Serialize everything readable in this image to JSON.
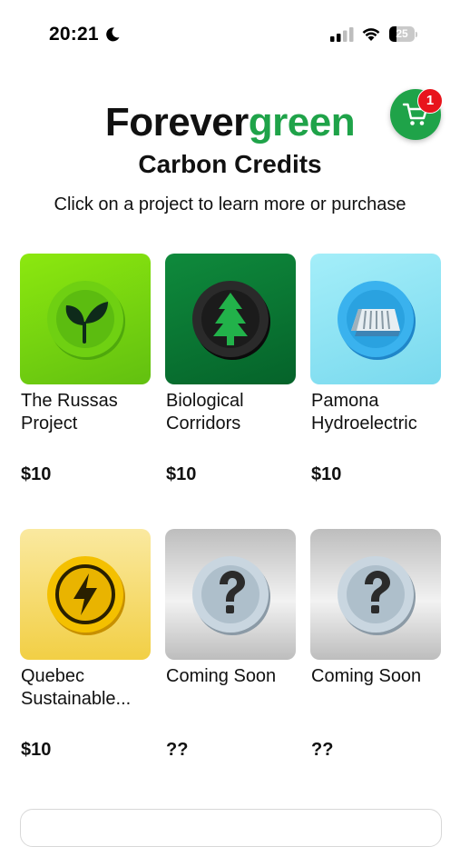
{
  "status_bar": {
    "time": "20:21",
    "battery": "25"
  },
  "header": {
    "brand_part1": "Forever",
    "brand_part2": "green",
    "subtitle": "Carbon Credits",
    "instructions": "Click on a project to learn more or purchase",
    "cart_count": "1"
  },
  "projects": [
    {
      "title": "The Russas Project",
      "price": "$10",
      "icon": "leaf-icon",
      "tile_color": "#7fd60f"
    },
    {
      "title": "Biological Corridors",
      "price": "$10",
      "icon": "tree-icon",
      "tile_color": "#0d7a35"
    },
    {
      "title": "Pamona Hydroelectric",
      "price": "$10",
      "icon": "dam-icon",
      "tile_color": "#8fe6f4"
    },
    {
      "title": "Quebec Sustainable...",
      "price": "$10",
      "icon": "lightning-icon",
      "tile_color": "#f4d660"
    },
    {
      "title": "Coming Soon",
      "price": "??",
      "icon": "question-mark-icon",
      "tile_color": "#c4c4c4"
    },
    {
      "title": "Coming Soon",
      "price": "??",
      "icon": "question-mark-icon",
      "tile_color": "#c4c4c4"
    }
  ],
  "colors": {
    "brand_green": "#1fa349",
    "badge_red": "#e8141c"
  }
}
